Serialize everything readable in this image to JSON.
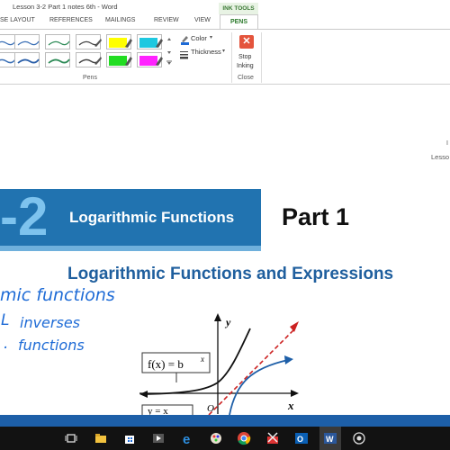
{
  "window": {
    "title": "Lesson 3-2 Part 1 notes 6th - Word",
    "context_tab": "INK TOOLS"
  },
  "tabs": [
    "SE LAYOUT",
    "REFERENCES",
    "MAILINGS",
    "REVIEW",
    "VIEW",
    "PENS"
  ],
  "ribbon": {
    "color_label": "Color",
    "thickness_label": "Thickness",
    "stop_inking_line1": "Stop",
    "stop_inking_line2": "Inking",
    "group_pens": "Pens",
    "group_close": "Close",
    "pen_colors_row1": [
      "#3a6fb5",
      "#3a6fb5",
      "#2e8b57",
      "#444444",
      "#ffff00",
      "#1ec8e0"
    ],
    "pen_colors_row2": [
      "#3a6fb5",
      "#2b5fa8",
      "#2e8b57",
      "#444444",
      "#22dd22",
      "#ff22ff"
    ]
  },
  "document": {
    "side_letter": "I",
    "side_label": "Lesso",
    "banner_number": "-2",
    "banner_title": "Logarithmic Functions",
    "part_label": "Part 1",
    "subheading": "Logarithmic Functions and Expressions",
    "handwriting": [
      "mic functions",
      "inverses",
      "functions"
    ],
    "handwriting_marks": [
      "L",
      "."
    ],
    "graph": {
      "y_label": "y",
      "x_label": "x",
      "origin_label": "O",
      "box_label_base": "f(x) = b",
      "box_label_exp": "x",
      "box2_label": "y = x"
    }
  },
  "colors": {
    "banner_blue": "#2173b0",
    "accent_green": "#2b7a2b",
    "taskbar": "#121212",
    "taskbar_strip": "#1d5fa8"
  },
  "taskbar": {
    "icons": [
      "task-view-icon",
      "file-explorer-icon",
      "store-icon",
      "media-player-icon",
      "edge-icon",
      "paint-icon",
      "chrome-icon",
      "snipping-tool-icon",
      "outlook-icon",
      "word-icon",
      "record-icon"
    ]
  }
}
